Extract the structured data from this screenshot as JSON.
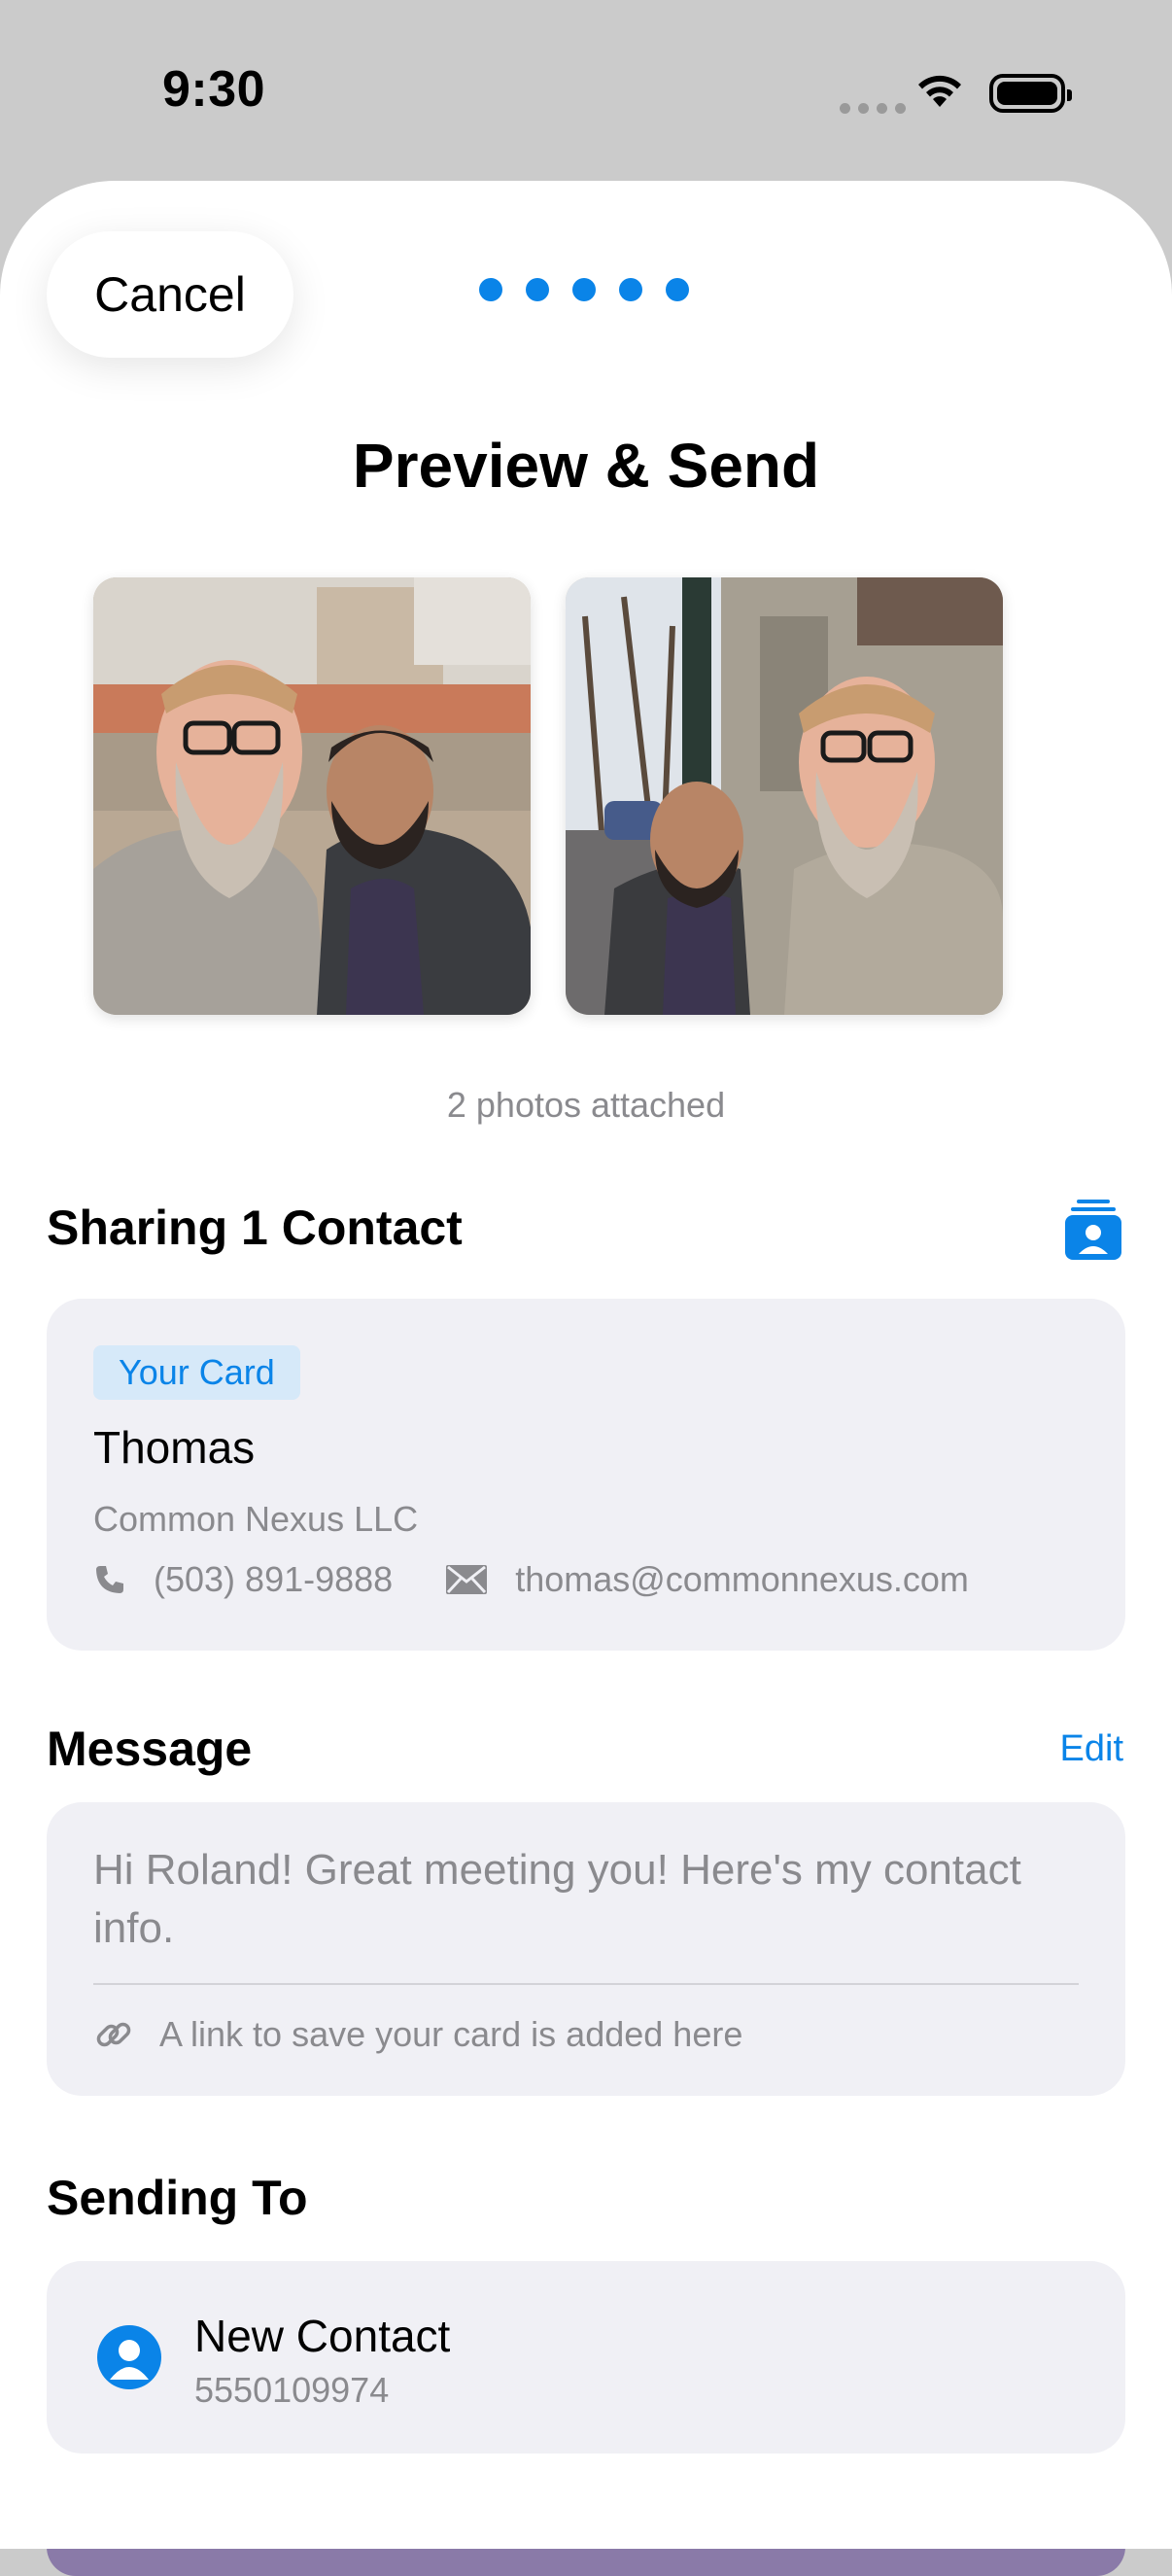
{
  "status_bar": {
    "time": "9:30"
  },
  "header": {
    "cancel_label": "Cancel",
    "page_indicator": {
      "total": 5,
      "color": "#0a84e8"
    },
    "title": "Preview & Send"
  },
  "photos": {
    "caption": "2 photos attached"
  },
  "sharing": {
    "heading": "Sharing 1 Contact",
    "card": {
      "badge": "Your Card",
      "name": "Thomas",
      "company": "Common Nexus LLC",
      "phone": "(503) 891-9888",
      "email": "thomas@commonnexus.com"
    }
  },
  "message": {
    "heading": "Message",
    "edit_label": "Edit",
    "text": "Hi Roland! Great meeting you! Here's my contact info.",
    "link_note": "A link to save your card is added here"
  },
  "sending_to": {
    "heading": "Sending To",
    "recipient": {
      "name": "New Contact",
      "phone": "5550109974"
    }
  },
  "colors": {
    "accent": "#0a84e8",
    "card_bg": "#f0f0f5",
    "secondary_text": "#8a8a8e"
  }
}
